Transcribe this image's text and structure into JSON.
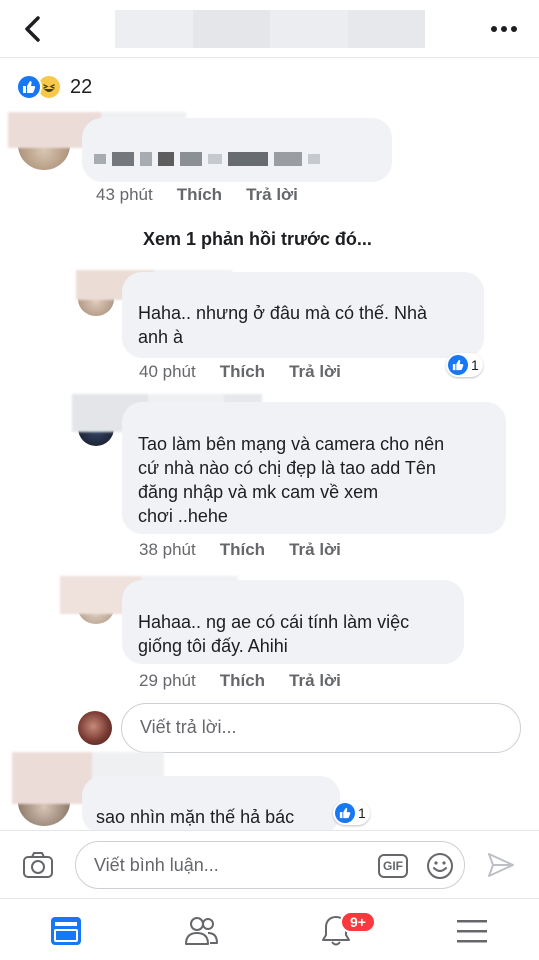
{
  "header": {
    "back_icon": "chevron-left-icon",
    "more_icon": "more-horizontal-icon"
  },
  "post_reactions": {
    "icons": [
      "like-icon",
      "haha-icon"
    ],
    "count": "22"
  },
  "comments": [
    {
      "time": "43 phút",
      "like_label": "Thích",
      "reply_label": "Trả lời"
    }
  ],
  "view_previous_replies": "Xem 1 phản hồi trước đó...",
  "replies": [
    {
      "text_lines": [
        "Haha.. nhưng ở đâu mà có thế. Nhà",
        "anh à"
      ],
      "time": "40 phút",
      "like_label": "Thích",
      "reply_label": "Trả lời",
      "reaction_count": "1"
    },
    {
      "text_lines": [
        "Tao làm bên mạng và camera cho nên",
        "cứ nhà nào có chị đẹp là tao add Tên",
        "đăng nhập và mk cam về xem",
        "chơi ..hehe"
      ],
      "time": "38 phút",
      "like_label": "Thích",
      "reply_label": "Trả lời"
    },
    {
      "text_lines": [
        "Hahaa.. ng ae có cái tính làm việc",
        "giống tôi đấy. Ahihi"
      ],
      "time": "29 phút",
      "like_label": "Thích",
      "reply_label": "Trả lời"
    }
  ],
  "reply_input": {
    "placeholder": "Viết trả lời..."
  },
  "last_comment": {
    "text": "sao nhìn mặn thế hả bác",
    "reaction_count": "1"
  },
  "composer": {
    "placeholder": "Viết bình luận...",
    "gif_label": "GIF",
    "camera_icon": "camera-icon",
    "emoji_icon": "emoji-icon",
    "send_icon": "send-icon"
  },
  "tabbar": {
    "tabs": [
      "news-feed-icon",
      "friends-icon",
      "notifications-icon",
      "menu-icon"
    ],
    "notification_badge": "9+"
  },
  "colors": {
    "accent": "#1877f2",
    "badge": "#fa383e",
    "bubble": "#f0f2f5",
    "muted": "#65676b"
  }
}
